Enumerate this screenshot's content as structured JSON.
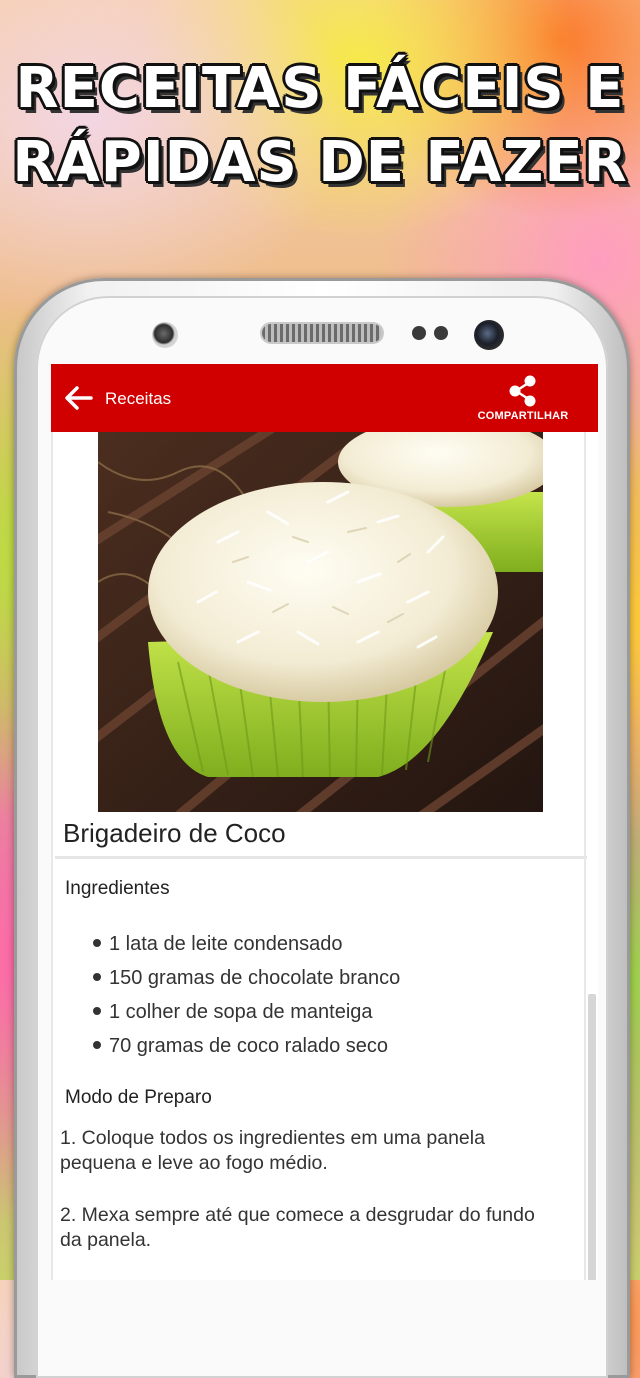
{
  "promo": {
    "headline_line1": "Receitas fáceis e",
    "headline_line2": "rápidas de fazer"
  },
  "appbar": {
    "back_icon": "arrow-left-icon",
    "title": "Receitas",
    "share_icon": "share-icon",
    "share_label": "COMPARTILHAR",
    "color": "#d10000"
  },
  "recipe": {
    "title": "Brigadeiro de Coco",
    "ingredients_title": "Ingredientes",
    "ingredients": [
      "1 lata de leite condensado",
      "150 gramas de chocolate branco",
      "1 colher de sopa de manteiga",
      "70 gramas de coco ralado seco"
    ],
    "method_title": "Modo de Preparo",
    "steps": [
      "1. Coloque todos os ingredientes em uma panela pequena e leve ao fogo médio.",
      "2. Mexa sempre até que comece a desgrudar do fundo da panela."
    ]
  }
}
